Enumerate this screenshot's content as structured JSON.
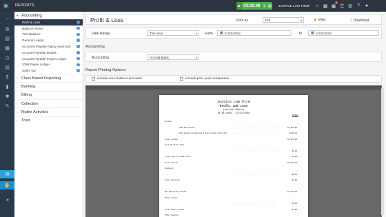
{
  "topbar": {
    "title": "REPORTS",
    "timer": "03:02:48",
    "firm": "JUSTICE LAW FIRM",
    "badge_count": "2",
    "icons": [
      "chat-icon",
      "bank-icon",
      "calendar-icon",
      "inbox-icon",
      "list-icon",
      "grid-icon",
      "help-icon",
      "user-icon"
    ]
  },
  "sidebar": {
    "section": "Accounting",
    "items": [
      {
        "label": "Profit & Loss",
        "active": true
      },
      {
        "label": "Balance Sheet"
      },
      {
        "label": "Trial Balance"
      },
      {
        "label": "General Ledger"
      },
      {
        "label": "Accounts Payable Aging Summary"
      },
      {
        "label": "Account Payable Details"
      },
      {
        "label": "Account Payable Payee Ledger"
      },
      {
        "label": "1099 Payee Ledger"
      },
      {
        "label": "Sales Tax"
      }
    ],
    "groups": [
      "Class Based Reporting",
      "Banking",
      "Billing",
      "Collection",
      "Matter Activities",
      "Trust"
    ]
  },
  "header": {
    "title": "Profit & Loss",
    "print_as_label": "Print as",
    "print_as_value": "Pdf",
    "view_label": "View",
    "download_label": "Download"
  },
  "filters": {
    "date_range_label": "Date Range",
    "date_range_value": "This Year",
    "from_label": "From",
    "from_value": "01/01/2018",
    "to_label": "To",
    "to_value": "12/31/2018"
  },
  "accounting": {
    "section_label": "Accounting",
    "field_label": "Accounting",
    "field_value": "Accrual Basis"
  },
  "options": {
    "section_label": "Report Printing Options",
    "include_zero": "Include zero balance accounts",
    "include_prior": "Include prior year comparison"
  },
  "report": {
    "firm": "Justice Law Firm",
    "title": "Profit and Loss",
    "basis": "(Accrual Basis)",
    "period": "01/01/2018 - 12/31/2018",
    "total_label": "Total",
    "rows": [
      {
        "label": "Income",
        "value": "",
        "indent": 0
      },
      {
        "label": "1120-Fee Income",
        "value": "$4,555.00",
        "indent": 2
      },
      {
        "label": "1210-Income Reimbursed Client Costs (Cost Rec...",
        "value": "$120.00",
        "indent": 2
      },
      {
        "label": "Total Income",
        "value": "$4,675.00",
        "indent": 0
      },
      {
        "label": "Cost Of Goods Sold",
        "value": "",
        "indent": 0
      },
      {
        "label": "",
        "value": "$0.00",
        "indent": 2
      },
      {
        "label": "Total Cost Of Goods Sold",
        "value": "$0.00",
        "indent": 0
      },
      {
        "label": "Gross Profit",
        "value": "$4,675.00",
        "indent": 0
      },
      {
        "label": "Expenses",
        "value": "",
        "indent": 0
      },
      {
        "label": "",
        "value": "$0.00",
        "indent": 2
      },
      {
        "label": "Total Expenses",
        "value": "$0.00",
        "indent": 0
      },
      {
        "label": "",
        "value": "",
        "indent": 0
      },
      {
        "label": "Net Operating Income",
        "value": "$4,675.00",
        "indent": 0
      },
      {
        "label": "Other Income",
        "value": "",
        "indent": 0
      },
      {
        "label": "",
        "value": "$0.00",
        "indent": 2
      },
      {
        "label": "Total Other Income",
        "value": "$0.00",
        "indent": 0
      },
      {
        "label": "Other Expense",
        "value": "",
        "indent": 0
      }
    ]
  }
}
